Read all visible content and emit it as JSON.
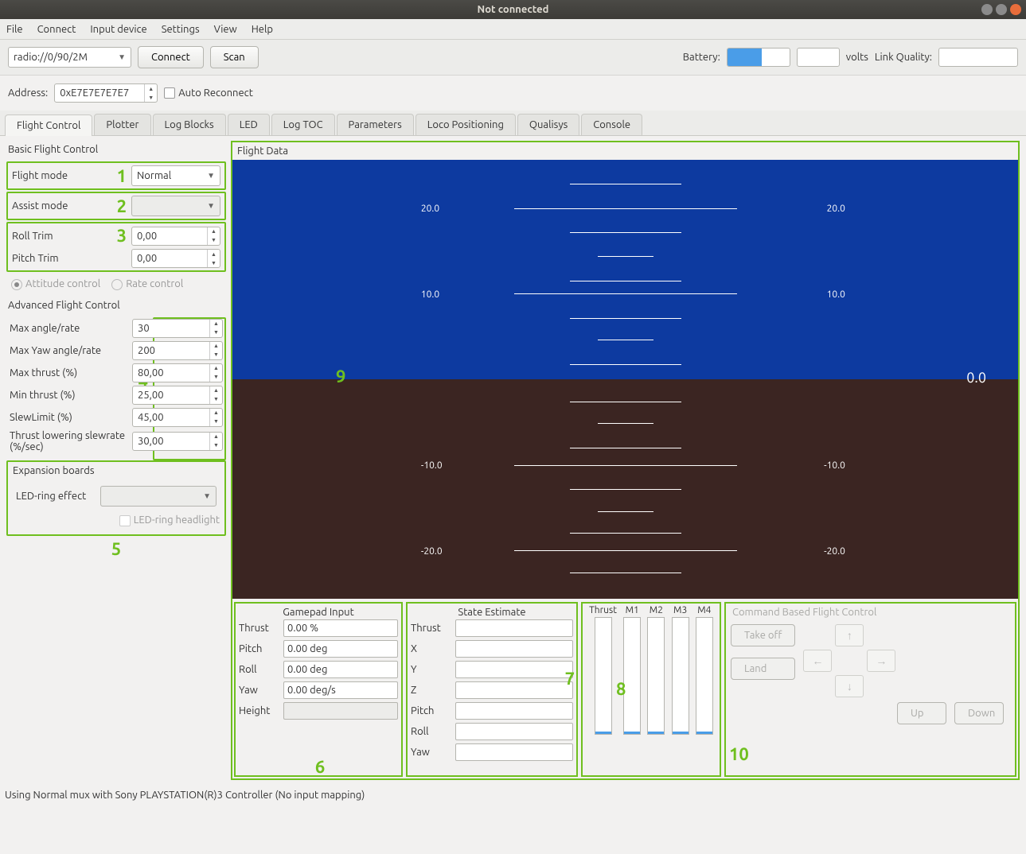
{
  "window": {
    "title": "Not connected"
  },
  "menu": [
    "File",
    "Connect",
    "Input device",
    "Settings",
    "View",
    "Help"
  ],
  "toolbar": {
    "uri": "radio://0/90/2M",
    "connect": "Connect",
    "scan": "Scan",
    "battery_label": "Battery:",
    "volts_label": "volts",
    "link_quality_label": "Link Quality:"
  },
  "address_row": {
    "label": "Address:",
    "value": "0xE7E7E7E7E7",
    "auto_reconnect": "Auto Reconnect"
  },
  "tabs": [
    "Flight Control",
    "Plotter",
    "Log Blocks",
    "LED",
    "Log TOC",
    "Parameters",
    "Loco Positioning",
    "Qualisys",
    "Console"
  ],
  "basic": {
    "title": "Basic Flight Control",
    "flight_mode": {
      "label": "Flight mode",
      "value": "Normal"
    },
    "assist_mode": {
      "label": "Assist mode",
      "value": ""
    },
    "roll_trim": {
      "label": "Roll Trim",
      "value": "0,00"
    },
    "pitch_trim": {
      "label": "Pitch Trim",
      "value": "0,00"
    },
    "attitude_control": "Attitude control",
    "rate_control": "Rate control"
  },
  "advanced": {
    "title": "Advanced Flight Control",
    "rows": [
      {
        "label": "Max angle/rate",
        "value": "30"
      },
      {
        "label": "Max Yaw angle/rate",
        "value": "200"
      },
      {
        "label": "Max thrust (%)",
        "value": "80,00"
      },
      {
        "label": "Min thrust (%)",
        "value": "25,00"
      },
      {
        "label": "SlewLimit (%)",
        "value": "45,00"
      },
      {
        "label": "Thrust lowering slewrate (%/sec)",
        "value": "30,00"
      }
    ]
  },
  "expansion": {
    "title": "Expansion boards",
    "led_effect_label": "LED-ring effect",
    "led_headlight": "LED-ring headlight"
  },
  "flight_data": {
    "title": "Flight Data",
    "ticks": [
      "20.0",
      "10.0",
      "-10.0",
      "-20.0"
    ],
    "zero": "0.0"
  },
  "gamepad": {
    "title": "Gamepad Input",
    "rows": [
      {
        "label": "Thrust",
        "value": "0.00 %"
      },
      {
        "label": "Pitch",
        "value": "0.00 deg"
      },
      {
        "label": "Roll",
        "value": "0.00 deg"
      },
      {
        "label": "Yaw",
        "value": "0.00 deg/s"
      },
      {
        "label": "Height",
        "value": ""
      }
    ]
  },
  "state": {
    "title": "State Estimate",
    "rows": [
      "Thrust",
      "X",
      "Y",
      "Z",
      "Pitch",
      "Roll",
      "Yaw"
    ]
  },
  "motors": {
    "labels": [
      "Thrust",
      "M1",
      "M2",
      "M3",
      "M4"
    ]
  },
  "cmd": {
    "title": "Command Based Flight Control",
    "takeoff": "Take off",
    "land": "Land",
    "up": "Up",
    "down": "Down"
  },
  "annotations": {
    "1": "1",
    "2": "2",
    "3": "3",
    "4": "4",
    "5": "5",
    "6": "6",
    "7": "7",
    "8": "8",
    "9": "9",
    "10": "10"
  },
  "status": "Using Normal mux with Sony PLAYSTATION(R)3 Controller (No input mapping)"
}
